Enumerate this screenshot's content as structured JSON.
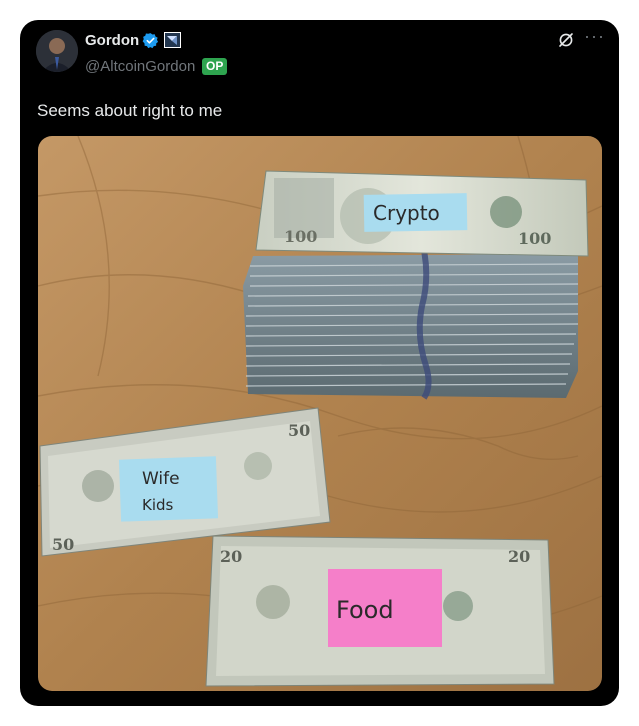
{
  "post": {
    "author_name": "Gordon",
    "author_handle": "@AltcoinGordon",
    "op_badge": "OP",
    "more_label": "···",
    "text": "Seems about right to me"
  },
  "media": {
    "notes": {
      "top": "Crypto",
      "middle_line1": "Wife",
      "middle_line2": "Kids",
      "bottom": "Food"
    },
    "bill_denominations": {
      "top": "100",
      "middle": "50",
      "bottom": "20"
    }
  },
  "colors": {
    "card_bg": "#000000",
    "name": "#e7e9ea",
    "handle": "#71767b",
    "verified": "#1d9bf0",
    "op_badge": "#2ea44f",
    "note_blue": "#a9dcef",
    "note_pink": "#f57fc9",
    "table": "#b58a55"
  },
  "icons": [
    "verified-badge-icon",
    "affiliate-badge-icon",
    "grok-icon",
    "more-icon"
  ]
}
